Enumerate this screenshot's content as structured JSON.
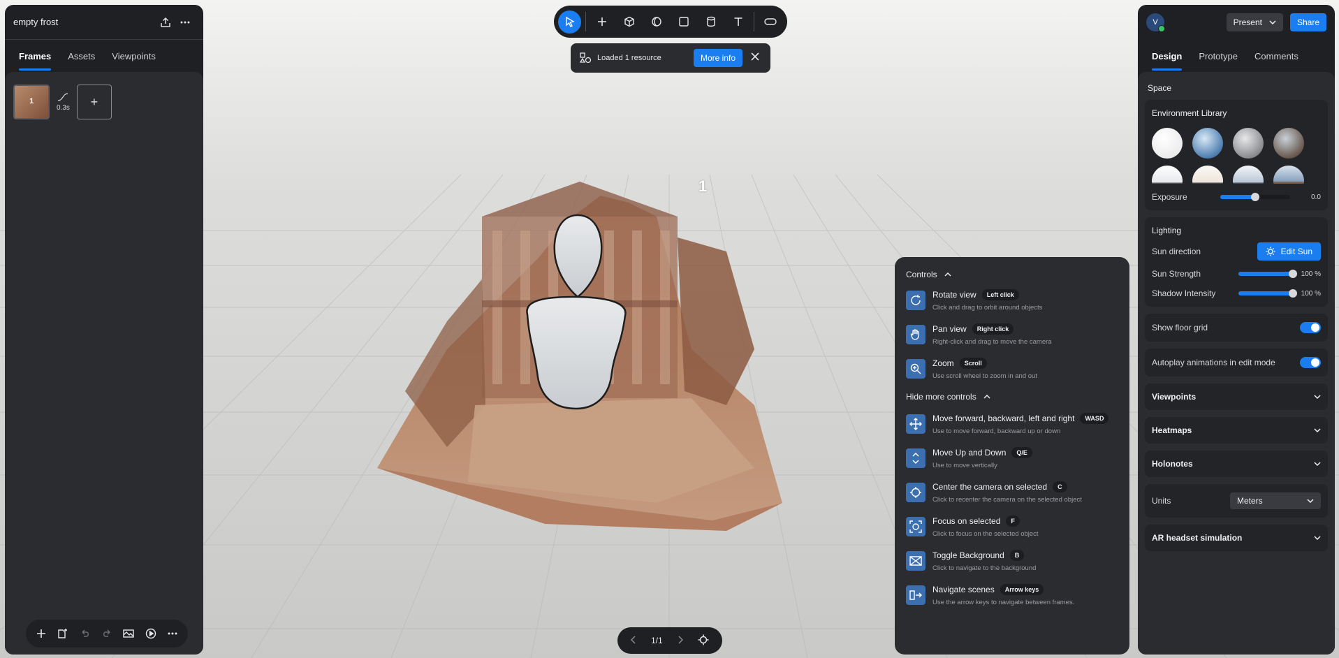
{
  "project": {
    "title": "empty frost"
  },
  "left_tabs": [
    {
      "label": "Frames"
    },
    {
      "label": "Assets"
    },
    {
      "label": "Viewpoints"
    }
  ],
  "frames": {
    "items": [
      {
        "number": "1",
        "transition": "0.3s"
      }
    ],
    "add_label": "+"
  },
  "viewport": {
    "frame_marker": "1"
  },
  "notification": {
    "text": "Loaded 1 resource",
    "button": "More info"
  },
  "pager": {
    "label": "1/1"
  },
  "controls": {
    "title": "Controls",
    "items": [
      {
        "title": "Rotate view",
        "key": "Left click",
        "desc": "Click and drag to orbit around objects"
      },
      {
        "title": "Pan view",
        "key": "Right click",
        "desc": "Right-click and drag to move the camera"
      },
      {
        "title": "Zoom",
        "key": "Scroll",
        "desc": "Use scroll wheel to zoom in and out"
      }
    ],
    "more_label": "Hide more controls",
    "more_items": [
      {
        "title": "Move forward, backward, left and right",
        "key": "WASD",
        "desc": "Use to move forward, backward up or down"
      },
      {
        "title": "Move Up and Down",
        "key": "Q/E",
        "desc": "Use to move vertically"
      },
      {
        "title": "Center the camera on selected",
        "key": "C",
        "desc": "Click to recenter the camera on the selected object"
      },
      {
        "title": "Focus on selected",
        "key": "F",
        "desc": "Click to focus on the selected object"
      },
      {
        "title": "Toggle Background",
        "key": "B",
        "desc": "Click to navigate to the background"
      },
      {
        "title": "Navigate scenes",
        "key": "Arrow keys",
        "desc": "Use the arrow keys to navigate between frames."
      }
    ]
  },
  "header": {
    "avatar_initial": "V",
    "present": "Present",
    "share": "Share"
  },
  "right_tabs": [
    {
      "label": "Design"
    },
    {
      "label": "Prototype"
    },
    {
      "label": "Comments"
    }
  ],
  "design": {
    "space_label": "Space",
    "environment": {
      "title": "Environment Library",
      "exposure_label": "Exposure",
      "exposure_value": "0.0",
      "exposure_fraction": 0.5
    },
    "lighting": {
      "title": "Lighting",
      "sun_direction_label": "Sun direction",
      "edit_sun": "Edit Sun",
      "sun_strength_label": "Sun Strength",
      "sun_strength_value": "100 %",
      "sun_strength_fraction": 1.0,
      "shadow_label": "Shadow Intensity",
      "shadow_value": "100 %",
      "shadow_fraction": 1.0
    },
    "show_floor_grid": {
      "label": "Show floor grid",
      "on": true
    },
    "autoplay": {
      "label": "Autoplay animations in edit mode",
      "on": true
    },
    "viewpoints": "Viewpoints",
    "heatmaps": "Heatmaps",
    "holonotes": "Holonotes",
    "units": {
      "label": "Units",
      "value": "Meters"
    },
    "ar_headset": "AR headset simulation"
  },
  "colors": {
    "accent": "#1a7ef0",
    "panel": "#2b2c30",
    "panel_dark": "#1f2024"
  }
}
